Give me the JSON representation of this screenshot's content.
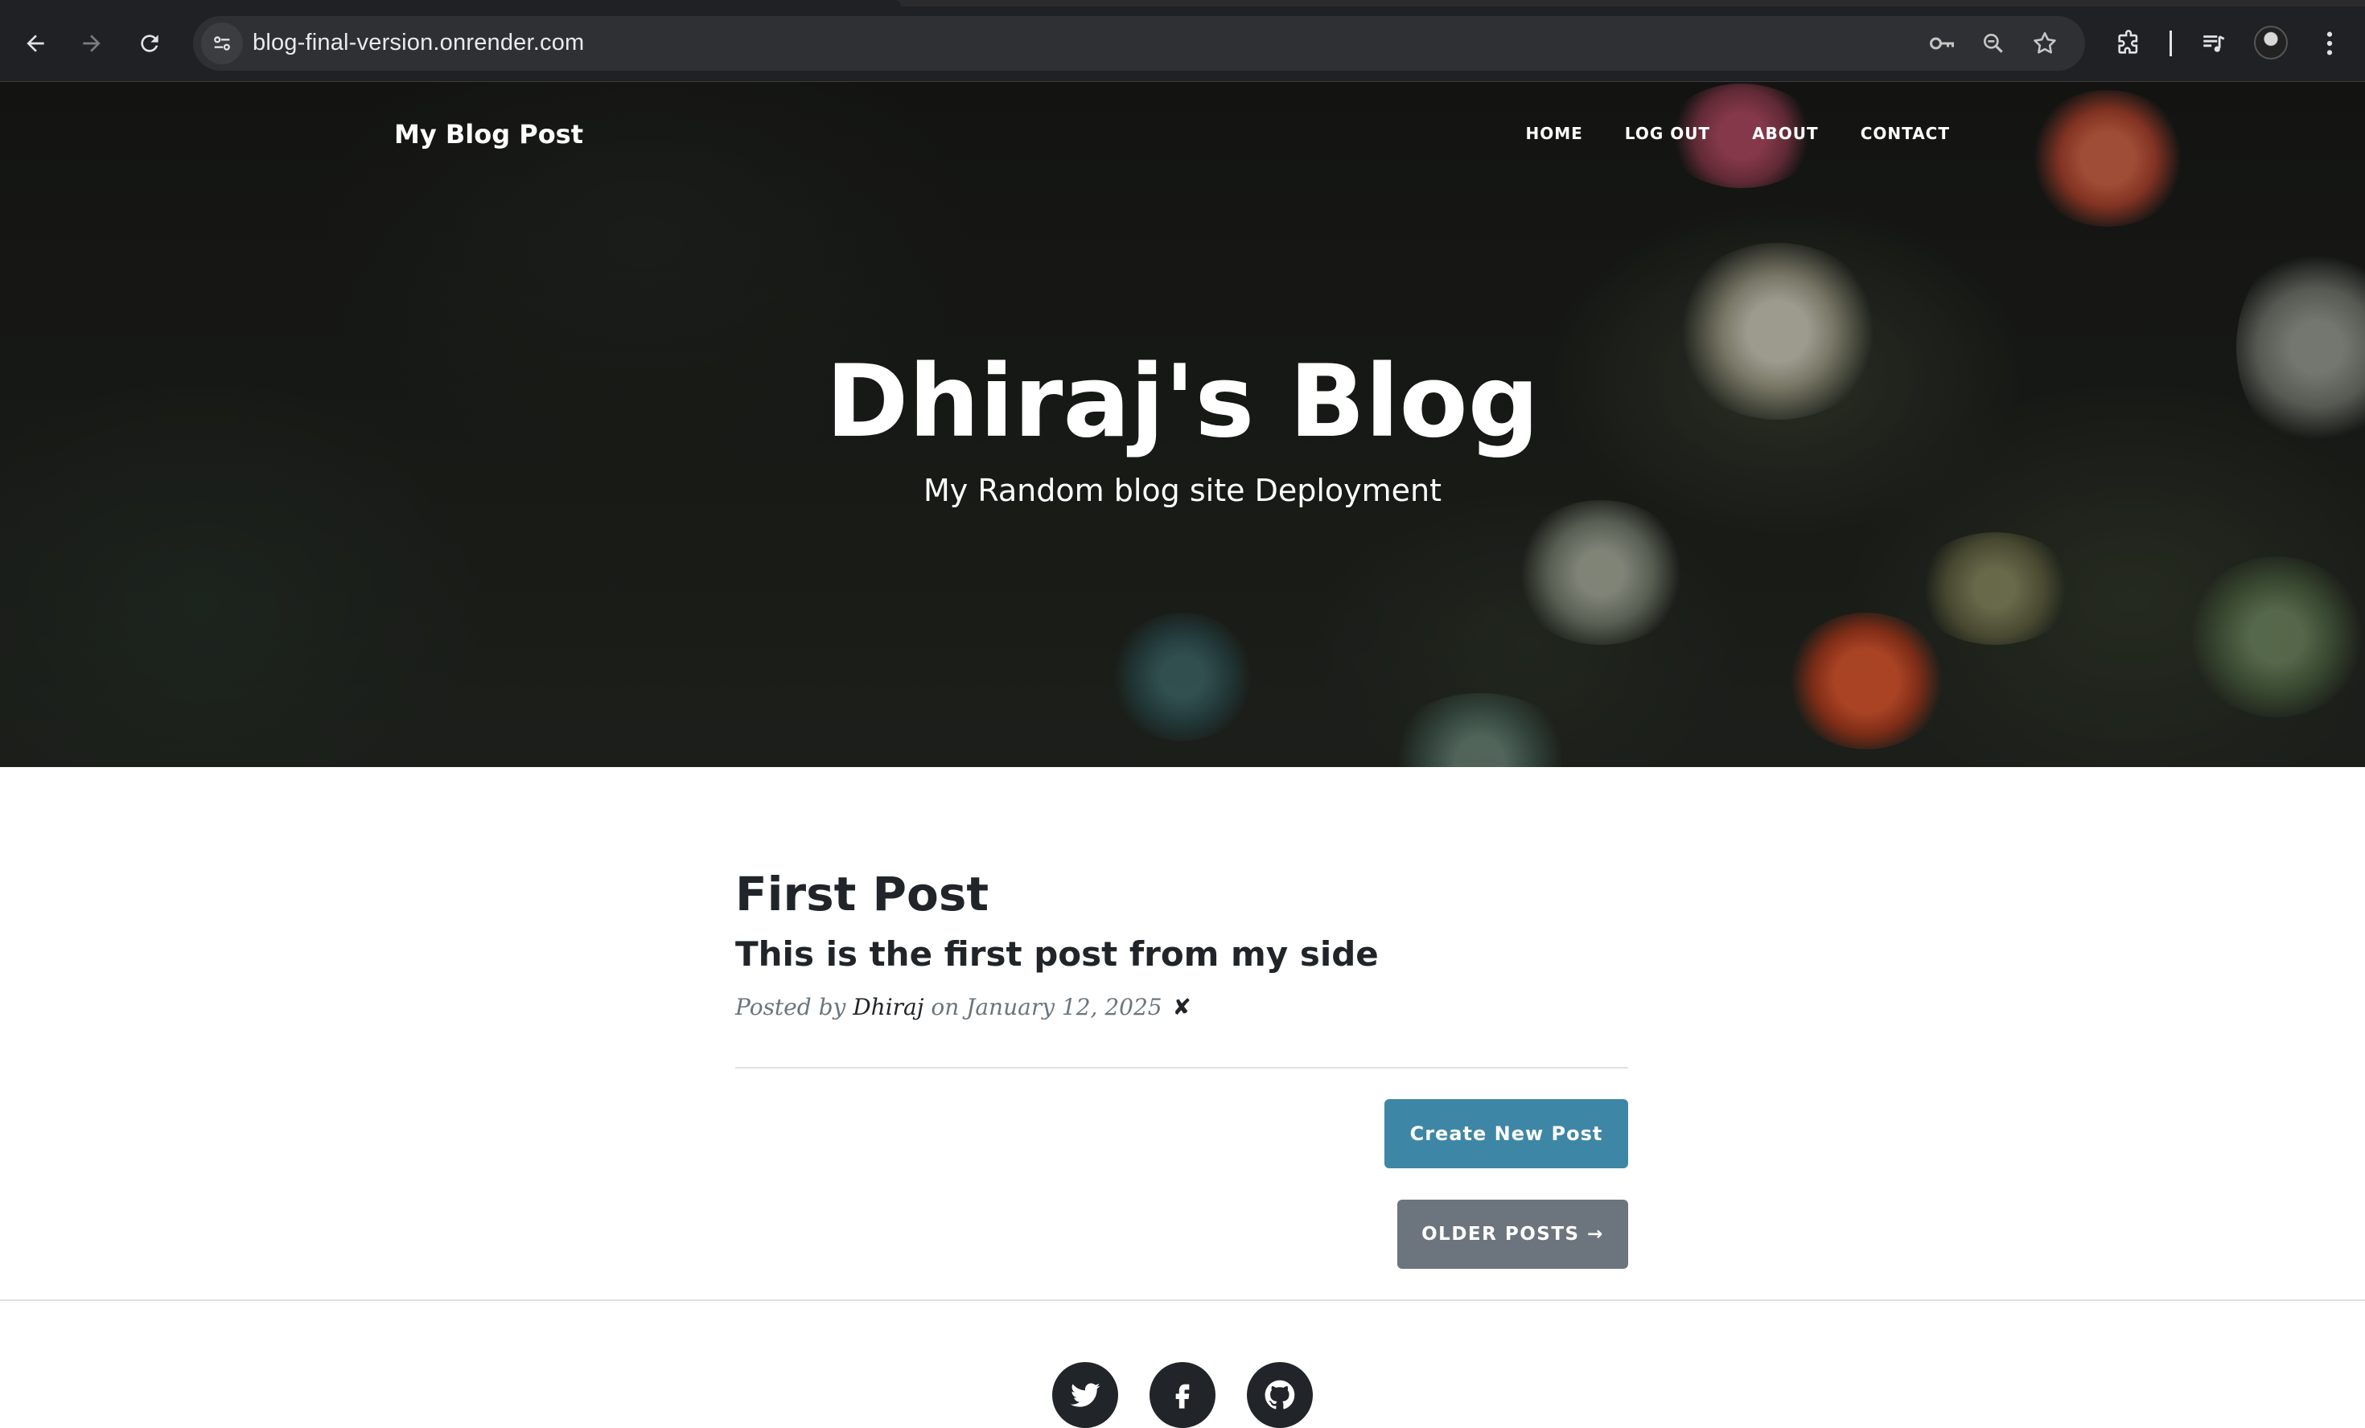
{
  "browser": {
    "url": "blog-final-version.onrender.com",
    "icons": [
      "back-icon",
      "forward-icon",
      "reload-icon",
      "site-info-icon",
      "password-key-icon",
      "zoom-icon",
      "bookmark-star-icon",
      "extensions-icon",
      "media-controls-icon",
      "profile-avatar",
      "menu-icon"
    ]
  },
  "navbar": {
    "brand": "My Blog Post",
    "links": [
      "HOME",
      "LOG OUT",
      "ABOUT",
      "CONTACT"
    ]
  },
  "hero": {
    "title": "Dhiraj's Blog",
    "subtitle": "My Random blog site Deployment"
  },
  "post": {
    "title": "First Post",
    "subtitle": "This is the first post from my side",
    "meta_prefix": "Posted by",
    "author": "Dhiraj",
    "meta_date": "on January 12, 2025",
    "delete_mark": "✘"
  },
  "buttons": {
    "create": "Create New Post",
    "older": "OLDER POSTS →"
  },
  "footer": {
    "social": [
      "twitter-icon",
      "facebook-icon",
      "github-icon"
    ]
  },
  "colors": {
    "primary_button": "#3e86a5",
    "secondary_button": "#6c757d",
    "text": "#212529",
    "muted": "#6c757d"
  }
}
